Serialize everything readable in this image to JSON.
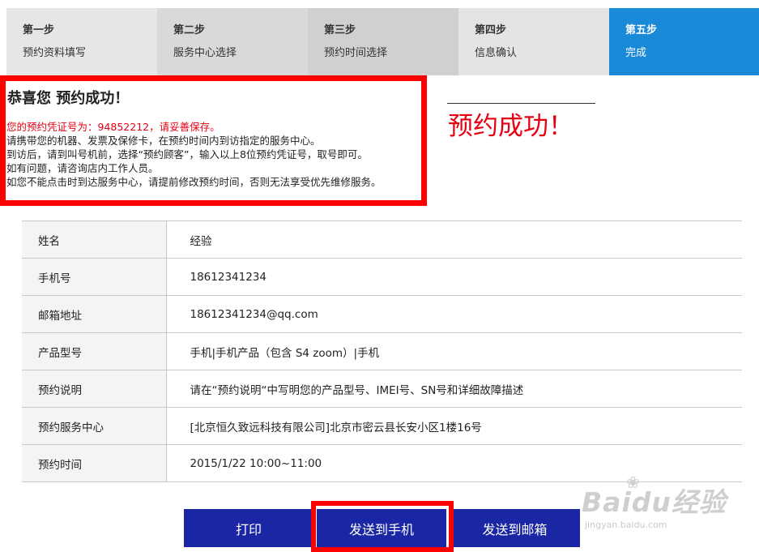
{
  "steps": [
    {
      "num": "第一步",
      "desc": "预约资料填写"
    },
    {
      "num": "第二步",
      "desc": "服务中心选择"
    },
    {
      "num": "第三步",
      "desc": "预约时间选择"
    },
    {
      "num": "第四步",
      "desc": "信息确认"
    },
    {
      "num": "第五步",
      "desc": "完成"
    }
  ],
  "success": {
    "title": "恭喜您 预约成功！",
    "voucher_line": "您的预约凭证号为：94852212，请妥善保存。",
    "lines": [
      "请携带您的机器、发票及保修卡，在预约时间内到访指定的服务中心。",
      "到访后，请到叫号机前，选择“预约顾客”，输入以上8位预约凭证号，取号即可。",
      "如有问题，请咨询店内工作人员。",
      "如您不能点击时到达服务中心，请提前修改预约时间，否则无法享受优先维修服务。"
    ]
  },
  "annotation": "预约成功！",
  "info": [
    {
      "label": "姓名",
      "value": "经验"
    },
    {
      "label": "手机号",
      "value": "18612341234"
    },
    {
      "label": "邮箱地址",
      "value": "18612341234@qq.com"
    },
    {
      "label": "产品型号",
      "value": "手机|手机产品（包含 S4 zoom）|手机"
    },
    {
      "label": "预约说明",
      "value": "请在“预约说明“中写明您的产品型号、IMEI号、SN号和详细故障描述"
    },
    {
      "label": "预约服务中心",
      "value": "[北京恒久致远科技有限公司]北京市密云县长安小区1楼16号"
    },
    {
      "label": "预约时间",
      "value": "2015/1/22 10:00~11:00"
    }
  ],
  "buttons": {
    "print": "打印",
    "send_phone": "发送到手机",
    "send_email": "发送到邮箱"
  },
  "watermark": {
    "logo": "Baidu经验",
    "url": "jingyan.baidu.com"
  },
  "colors": {
    "active_step": "#1a8ad8",
    "button": "#1a26a3",
    "highlight": "#ff0000",
    "voucher_text": "#e60012"
  }
}
